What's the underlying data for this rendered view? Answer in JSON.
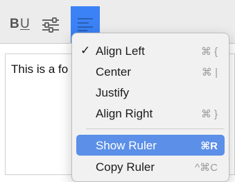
{
  "toolbar": {
    "bold_label": "B",
    "underline_label": "U",
    "settings_icon": "sliders-icon",
    "align_icon": "align-left-icon",
    "accent_color": "#3b82f6"
  },
  "editor": {
    "text": "This is a fo"
  },
  "menu": {
    "items": [
      {
        "label": "Align Left",
        "check": "✓",
        "shortcut": "⌘ {"
      },
      {
        "label": "Center",
        "check": "",
        "shortcut": "⌘ |"
      },
      {
        "label": "Justify",
        "check": "",
        "shortcut": ""
      },
      {
        "label": "Align Right",
        "check": "",
        "shortcut": "⌘ }"
      },
      {
        "label": "Show Ruler",
        "check": "",
        "shortcut": "⌘R"
      },
      {
        "label": "Copy Ruler",
        "check": "",
        "shortcut": "^⌘C"
      }
    ],
    "selected_color": "#5b8fe8"
  }
}
